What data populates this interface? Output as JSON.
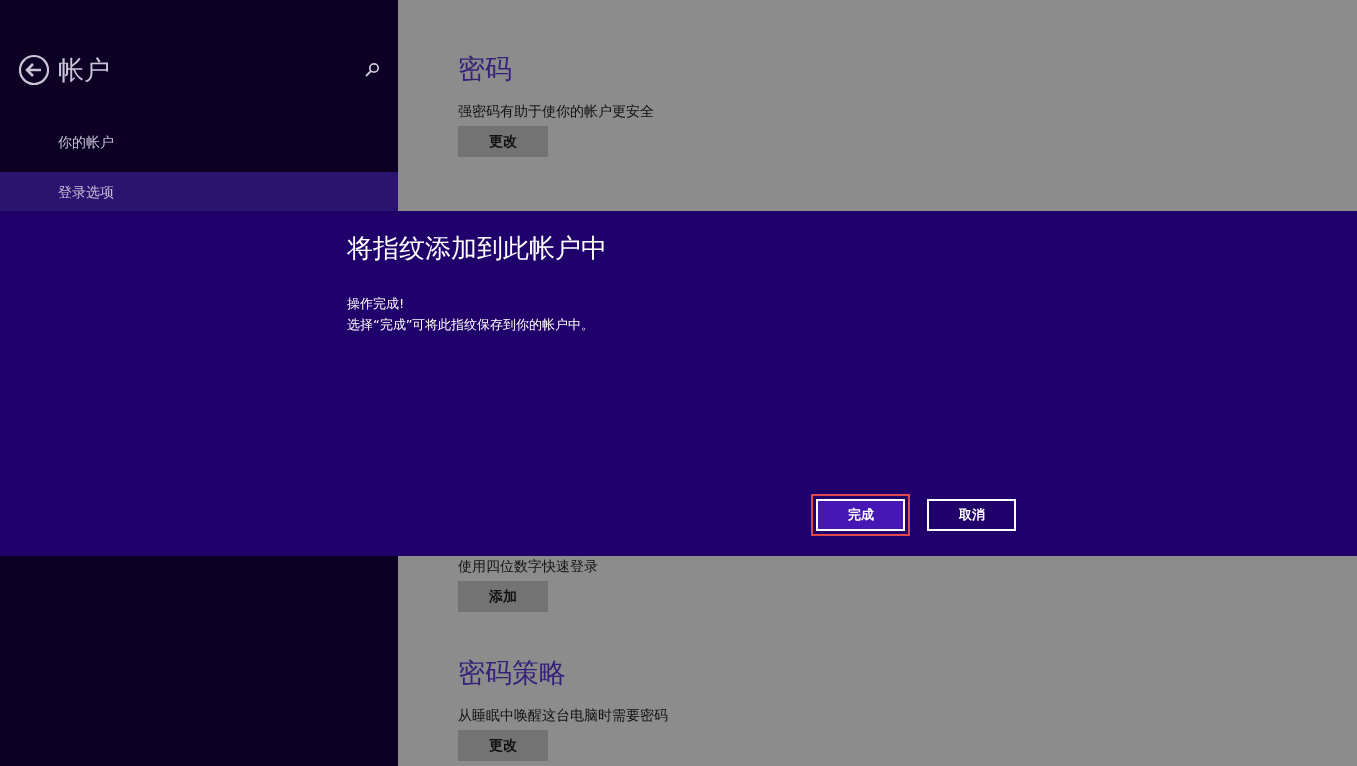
{
  "sidebar": {
    "title": "帐户",
    "items": [
      {
        "label": "你的帐户",
        "selected": false
      },
      {
        "label": "登录选项",
        "selected": true
      }
    ]
  },
  "content": {
    "above_dialog": [
      {
        "heading": "密码",
        "description": "强密码有助于使你的帐户更安全",
        "button": "更改"
      }
    ],
    "below_dialog": [
      {
        "description": "使用四位数字快速登录",
        "button": "添加"
      },
      {
        "heading": "密码策略",
        "description": "从睡眠中唤醒这台电脑时需要密码",
        "button": "更改"
      }
    ]
  },
  "dialog": {
    "title": "将指纹添加到此帐户中",
    "message": [
      "操作完成!",
      "选择“完成”可将此指纹保存到你的帐户中。"
    ],
    "buttons": [
      {
        "label": "完成",
        "kind": "primary",
        "highlighted": true
      },
      {
        "label": "取消",
        "kind": "secondary",
        "highlighted": false
      }
    ]
  }
}
